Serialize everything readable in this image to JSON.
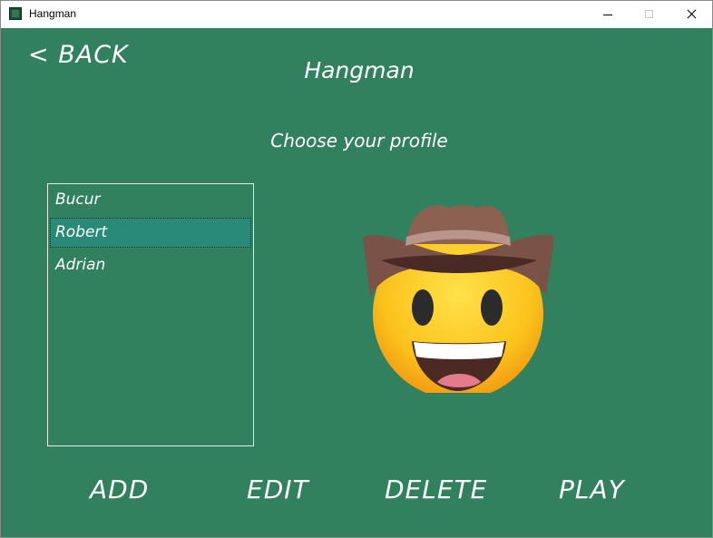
{
  "window": {
    "title": "Hangman"
  },
  "header": {
    "back_label": "< BACK",
    "title": "Hangman",
    "subtitle": "Choose your profile"
  },
  "profiles": {
    "items": [
      {
        "label": "Bucur"
      },
      {
        "label": "Robert"
      },
      {
        "label": "Adrian"
      }
    ],
    "selected": "Robert"
  },
  "avatar": {
    "icon": "cowboy-emoji-icon"
  },
  "actions": {
    "add_label": "ADD",
    "edit_label": "EDIT",
    "delete_label": "DELETE",
    "play_label": "PLAY"
  },
  "colors": {
    "background": "#31805e",
    "selected": "#2a8a78",
    "text": "#ffffff"
  }
}
